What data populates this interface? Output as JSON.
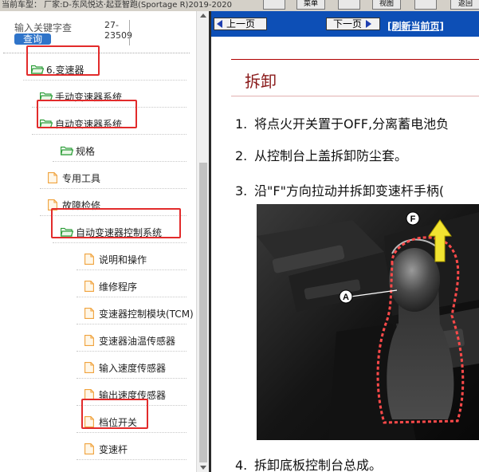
{
  "topbar": {
    "vehicle_info": "当前车型： 厂家:D-东风悦达·起亚智跑(Sportage R)2019-2020",
    "buttons": [
      "",
      "菜单",
      "",
      "视图",
      "",
      "返回"
    ]
  },
  "search": {
    "placeholder": "输入关键字查",
    "button_label": "查询",
    "code_line1": "27-",
    "code_line2": "23509"
  },
  "tree": {
    "items": [
      {
        "label": "6.变速器",
        "icon": "folder-open-icon",
        "level": 0
      },
      {
        "label": "手动变速器系统",
        "icon": "folder-open-icon",
        "level": 1
      },
      {
        "label": "自动变速器系统",
        "icon": "folder-open-icon",
        "level": 1
      },
      {
        "label": "规格",
        "icon": "folder-open-icon",
        "level": 2
      },
      {
        "label": "专用工具",
        "icon": "document-icon",
        "level": 2
      },
      {
        "label": "故障检修",
        "icon": "document-icon",
        "level": 2
      },
      {
        "label": "自动变速器控制系统",
        "icon": "folder-open-icon",
        "level": 2
      },
      {
        "label": "说明和操作",
        "icon": "document-icon",
        "level": 3
      },
      {
        "label": "维修程序",
        "icon": "document-icon",
        "level": 3
      },
      {
        "label": "变速器控制模块(TCM)",
        "icon": "document-icon",
        "level": 3
      },
      {
        "label": "变速器油温传感器",
        "icon": "document-icon",
        "level": 3
      },
      {
        "label": "输入速度传感器",
        "icon": "document-icon",
        "level": 3
      },
      {
        "label": "输出速度传感器",
        "icon": "document-icon",
        "level": 3
      },
      {
        "label": "档位开关",
        "icon": "document-icon",
        "level": 3
      },
      {
        "label": "变速杆",
        "icon": "document-icon",
        "level": 3
      }
    ]
  },
  "nav": {
    "prev_label": "上一页",
    "next_label": "下一页",
    "refresh_label": "[刷新当前页]"
  },
  "content": {
    "section_title": "拆卸",
    "steps": [
      {
        "num": "1.",
        "text": "将点火开关置于OFF,分离蓄电池负"
      },
      {
        "num": "2.",
        "text": "从控制台上盖拆卸防尘套。"
      },
      {
        "num": "3.",
        "text": "沿\"F\"方向拉动并拆卸变速杆手柄("
      },
      {
        "num": "4.",
        "text": "拆卸底板控制台总成。"
      }
    ],
    "photo_labels": {
      "f": "F",
      "a": "A"
    }
  },
  "colors": {
    "nav_blue": "#0d4fb6",
    "highlight_red": "#e22b2b",
    "title_red": "#8a1a1a",
    "folder_green": "#2e9e3a",
    "doc_orange": "#f0a23c"
  }
}
